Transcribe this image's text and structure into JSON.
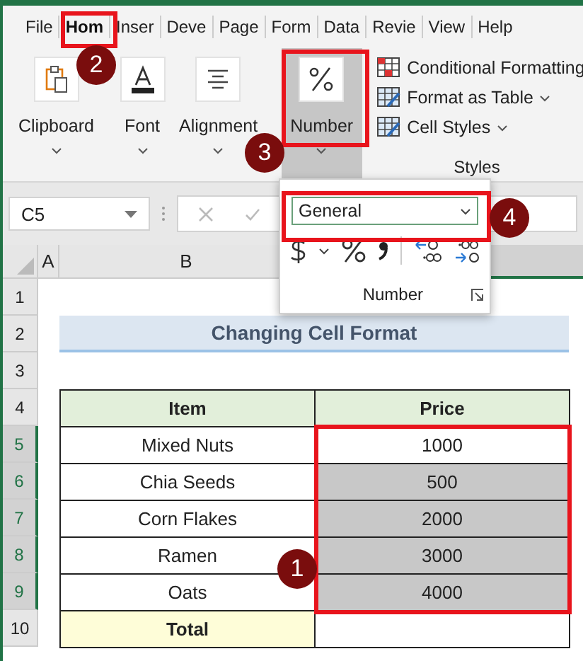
{
  "tabs": [
    {
      "label": "File",
      "selected": false
    },
    {
      "label": "Hom",
      "selected": true
    },
    {
      "label": "Inser",
      "selected": false
    },
    {
      "label": "Deve",
      "selected": false
    },
    {
      "label": "Page",
      "selected": false
    },
    {
      "label": "Form",
      "selected": false
    },
    {
      "label": "Data",
      "selected": false
    },
    {
      "label": "Revie",
      "selected": false
    },
    {
      "label": "View",
      "selected": false
    },
    {
      "label": "Help",
      "selected": false
    }
  ],
  "ribbon_groups": [
    {
      "kind": "clipboard",
      "label": "Clipboard",
      "selected": false
    },
    {
      "kind": "font",
      "label": "Font",
      "selected": false
    },
    {
      "kind": "alignment",
      "label": "Alignment",
      "selected": false
    },
    {
      "kind": "number",
      "label": "Number",
      "selected": true
    }
  ],
  "styles_group": {
    "label": "Styles",
    "items": [
      {
        "kind": "conditional",
        "label": "Conditional Formatting",
        "dropdown": false
      },
      {
        "kind": "table",
        "label": "Format as Table",
        "dropdown": true
      },
      {
        "kind": "cellstyles",
        "label": "Cell Styles",
        "dropdown": true
      }
    ]
  },
  "name_box": "C5",
  "number_popup": {
    "format": "General",
    "label": "Number"
  },
  "columns": [
    {
      "label": "A"
    },
    {
      "label": "B"
    }
  ],
  "row_headers": [
    {
      "label": "1",
      "selected": false
    },
    {
      "label": "2",
      "selected": false
    },
    {
      "label": "3",
      "selected": false
    },
    {
      "label": "4",
      "selected": false
    },
    {
      "label": "5",
      "selected": true
    },
    {
      "label": "6",
      "selected": true
    },
    {
      "label": "7",
      "selected": true
    },
    {
      "label": "8",
      "selected": true
    },
    {
      "label": "9",
      "selected": true
    },
    {
      "label": "10",
      "selected": false
    }
  ],
  "sheet_title": "Changing Cell Format",
  "table": {
    "headers": [
      "Item",
      "Price"
    ],
    "rows": [
      {
        "item": "Mixed Nuts",
        "price": "1000",
        "active": true
      },
      {
        "item": "Chia Seeds",
        "price": "500",
        "active": false
      },
      {
        "item": "Corn Flakes",
        "price": "2000",
        "active": false
      },
      {
        "item": "Ramen",
        "price": "3000",
        "active": false
      },
      {
        "item": "Oats",
        "price": "4000",
        "active": false
      }
    ],
    "total_label": "Total"
  },
  "callouts": [
    {
      "number": "2"
    },
    {
      "number": "3"
    },
    {
      "number": "4"
    },
    {
      "number": "1"
    }
  ]
}
